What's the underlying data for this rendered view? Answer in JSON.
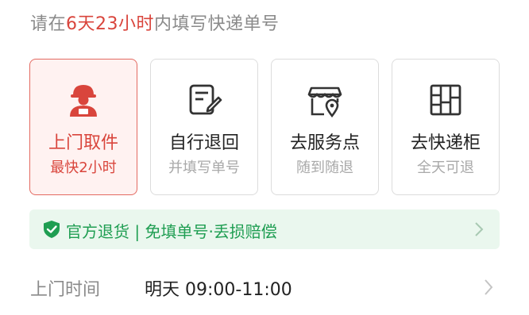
{
  "notice": {
    "prefix": "请在",
    "deadline": "6天23小时",
    "suffix": "内填写快递单号"
  },
  "methods": [
    {
      "title": "上门取件",
      "subtitle": "最快2小时",
      "icon": "courier-icon",
      "selected": true
    },
    {
      "title": "自行退回",
      "subtitle": "并填写单号",
      "icon": "edit-form-icon",
      "selected": false
    },
    {
      "title": "去服务点",
      "subtitle": "随到随退",
      "icon": "store-location-icon",
      "selected": false
    },
    {
      "title": "去快递柜",
      "subtitle": "全天可退",
      "icon": "locker-icon",
      "selected": false
    }
  ],
  "banner": {
    "text": "官方退货 | 免填单号·丢损赔偿",
    "icon": "shield-check-icon"
  },
  "pickup_time": {
    "label": "上门时间",
    "value": "明天 09:00-11:00"
  },
  "colors": {
    "accent": "#d9453c",
    "selected_bg": "#fff2f1",
    "success": "#1f9e52",
    "success_bg": "#eaf7ee"
  }
}
